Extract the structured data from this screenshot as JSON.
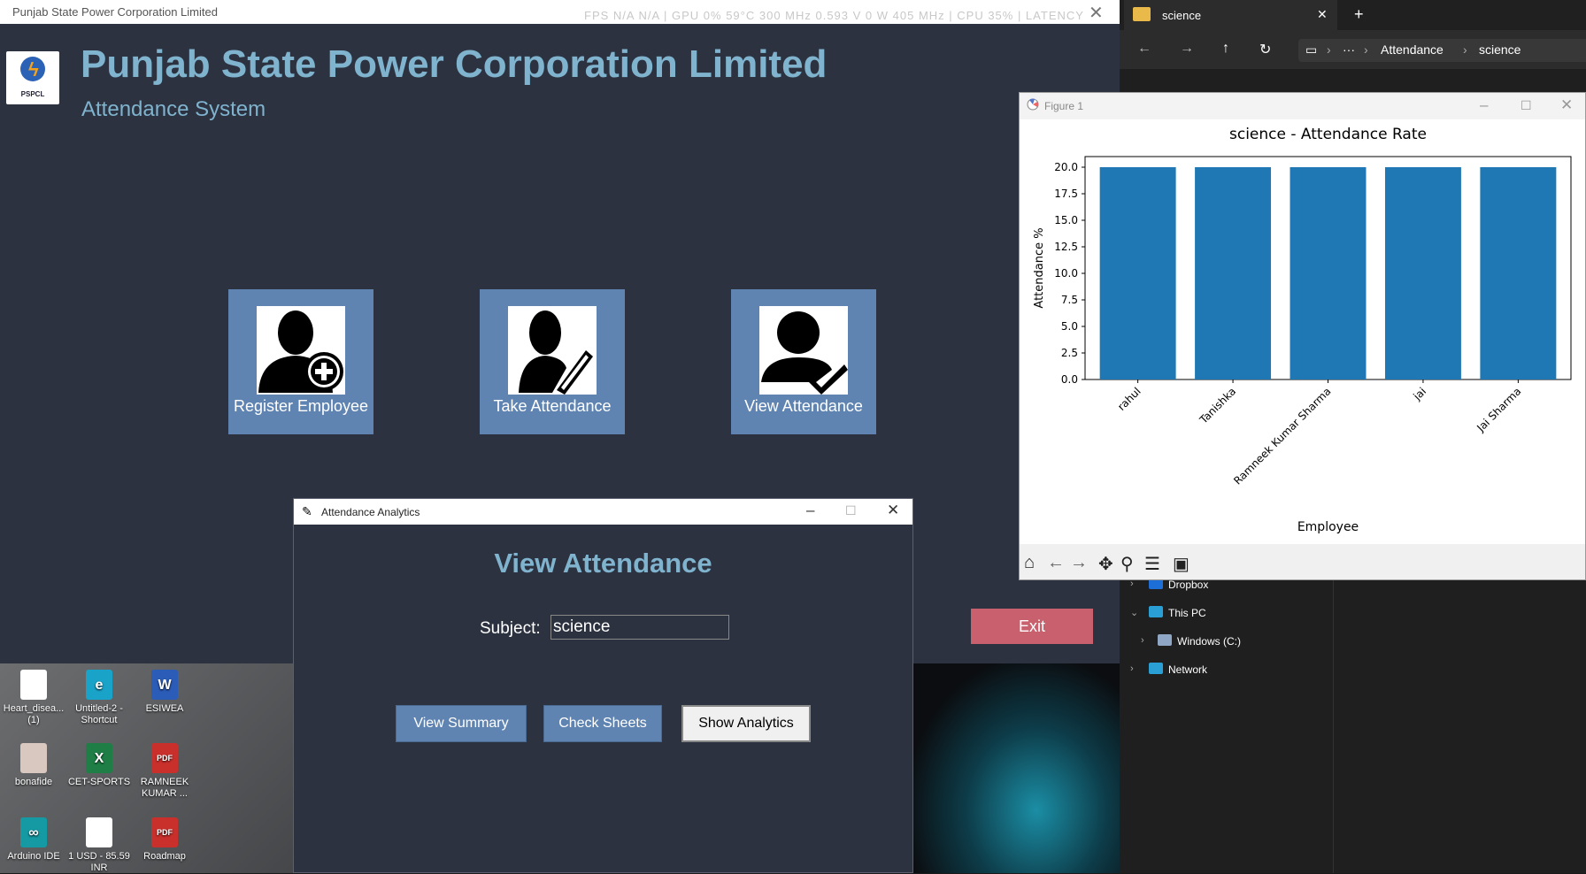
{
  "main_window": {
    "title": "Punjab State Power Corporation Limited",
    "hw_overlay": "FPS N/A  N/A  |  GPU  0%  59°C  300 MHz  0.593 V  0 W  405 MHz  |  CPU  35%  |  LATENCY",
    "logo_text": "PSPCL",
    "heading": "Punjab State Power Corporation Limited",
    "subheading": "Attendance System",
    "tiles": [
      {
        "label": "Register Employee",
        "icon": "user-add-icon"
      },
      {
        "label": "Take Attendance",
        "icon": "user-edit-icon"
      },
      {
        "label": "View Attendance",
        "icon": "user-check-icon"
      }
    ],
    "exit_label": "Exit",
    "colors": {
      "bg": "#2c3240",
      "accent": "#7fb3ce",
      "tile": "#5f84b1",
      "exit": "#c9606e"
    }
  },
  "dialog": {
    "title": "Attendance Analytics",
    "heading": "View Attendance",
    "subject_label": "Subject:",
    "subject_value": "science",
    "buttons": [
      "View Summary",
      "Check Sheets",
      "Show Analytics"
    ],
    "controls": {
      "minimize": "–",
      "maximize": "☐",
      "close": "✕"
    }
  },
  "desktop": {
    "icons": [
      {
        "label": "Heart_disea... (1)",
        "icon": "document-icon"
      },
      {
        "label": "Untitled-2 - Shortcut",
        "icon": "edge-icon"
      },
      {
        "label": "ESIWEA",
        "icon": "word-icon"
      },
      {
        "label": "bonafide",
        "icon": "image-icon"
      },
      {
        "label": "CET-SPORTS",
        "icon": "excel-icon"
      },
      {
        "label": "RAMNEEK KUMAR ...",
        "icon": "pdf-icon"
      },
      {
        "label": "Arduino IDE",
        "icon": "arduino-icon"
      },
      {
        "label": "1 USD - 85.59 INR",
        "icon": "document-icon"
      },
      {
        "label": "Roadmap",
        "icon": "pdf-icon"
      }
    ]
  },
  "explorer": {
    "tab_title": "science",
    "breadcrumb": [
      "Attendance",
      "science"
    ],
    "more": "···",
    "tree": [
      {
        "label": "Dropbox",
        "expanded": false
      },
      {
        "label": "This PC",
        "expanded": true
      },
      {
        "label": "Windows (C:)",
        "expanded": false
      },
      {
        "label": "Network",
        "expanded": false
      }
    ]
  },
  "figure": {
    "title": "Figure 1",
    "chart_data": {
      "type": "bar",
      "title": "science - Attendance Rate",
      "xlabel": "Employee",
      "ylabel": "Attendance %",
      "categories": [
        "rahul",
        "Tanishka",
        "Ramneek Kumar Sharma",
        "jai",
        "Jai Sharma"
      ],
      "values": [
        20.0,
        20.0,
        20.0,
        20.0,
        20.0
      ],
      "ylim": [
        0,
        21
      ],
      "yticks": [
        "0.0",
        "2.5",
        "5.0",
        "7.5",
        "10.0",
        "12.5",
        "15.0",
        "17.5",
        "20.0"
      ],
      "bar_color": "#1f77b4",
      "grid": false
    }
  }
}
